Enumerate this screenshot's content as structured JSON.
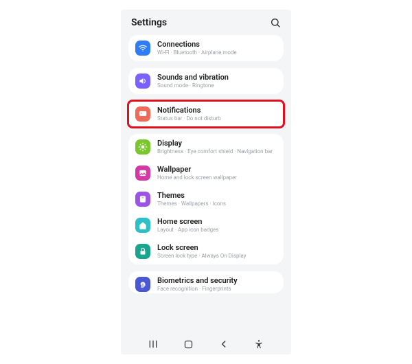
{
  "header": {
    "title": "Settings"
  },
  "groups": [
    {
      "highlight": false,
      "items": [
        {
          "key": "connections",
          "title": "Connections",
          "subtitle": "Wi-Fi · Bluetooth · Airplane mode",
          "icon": "wifi-icon",
          "color": "c-blue"
        }
      ]
    },
    {
      "highlight": false,
      "items": [
        {
          "key": "sounds",
          "title": "Sounds and vibration",
          "subtitle": "Sound mode · Ringtone",
          "icon": "volume-icon",
          "color": "c-purple"
        }
      ]
    },
    {
      "highlight": true,
      "items": [
        {
          "key": "notifications",
          "title": "Notifications",
          "subtitle": "Status bar · Do not disturb",
          "icon": "bell-icon",
          "color": "c-coral"
        }
      ]
    },
    {
      "highlight": false,
      "items": [
        {
          "key": "display",
          "title": "Display",
          "subtitle": "Brightness · Eye comfort shield · Navigation bar",
          "icon": "sun-icon",
          "color": "c-green"
        },
        {
          "key": "wallpaper",
          "title": "Wallpaper",
          "subtitle": "Home and lock screen wallpaper",
          "icon": "image-icon",
          "color": "c-magenta"
        },
        {
          "key": "themes",
          "title": "Themes",
          "subtitle": "Themes · Wallpapers · Icons",
          "icon": "palette-icon",
          "color": "c-violet"
        },
        {
          "key": "homescreen",
          "title": "Home screen",
          "subtitle": "Layout · App icon badges",
          "icon": "home-icon",
          "color": "c-teal"
        },
        {
          "key": "lockscreen",
          "title": "Lock screen",
          "subtitle": "Screen lock type · Always On Display",
          "icon": "lock-icon",
          "color": "c-tealdk"
        }
      ]
    },
    {
      "highlight": false,
      "cut": true,
      "items": [
        {
          "key": "biometrics",
          "title": "Biometrics and security",
          "subtitle": "Face recognition · Fingerprints",
          "icon": "fingerprint-icon",
          "color": "c-indigo"
        }
      ]
    }
  ]
}
